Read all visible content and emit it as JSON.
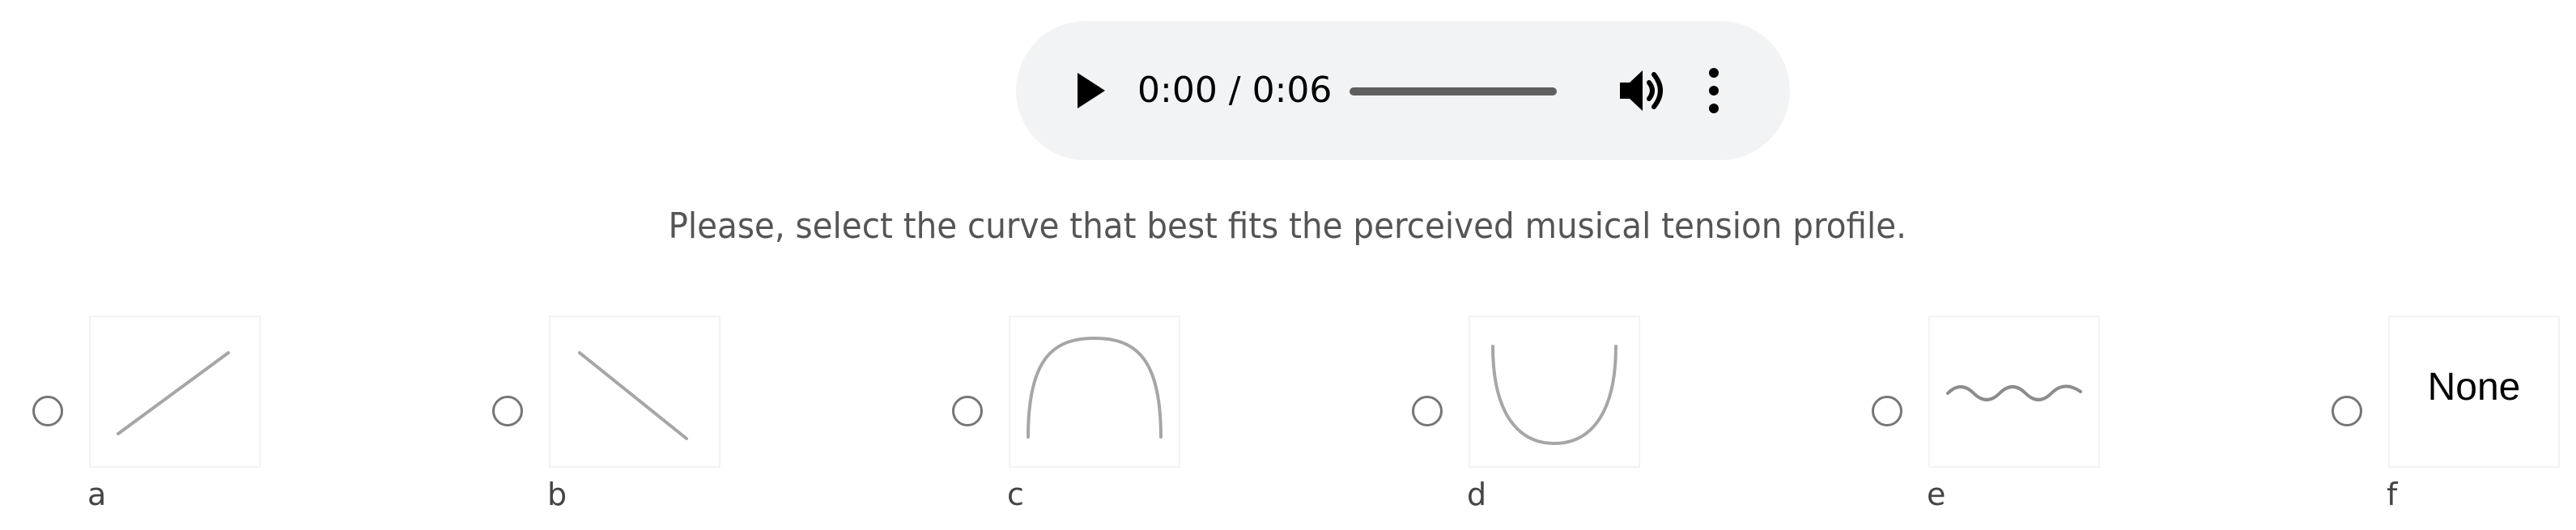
{
  "audio": {
    "time_display": "0:00 / 0:06",
    "icons": [
      "play-icon",
      "volume-icon",
      "more-vert-icon"
    ]
  },
  "prompt": "Please, select the curve that best fits the perceived musical tension profile.",
  "options": [
    {
      "label": "a",
      "curve": "rising-line"
    },
    {
      "label": "b",
      "curve": "falling-line"
    },
    {
      "label": "c",
      "curve": "arch"
    },
    {
      "label": "d",
      "curve": "valley"
    },
    {
      "label": "e",
      "curve": "wave"
    },
    {
      "label": "f",
      "curve": "none",
      "text": "None"
    }
  ],
  "colors": {
    "player_bg": "#f1f3f4",
    "curve_stroke": "#a6a6a6",
    "text": "#555555"
  }
}
